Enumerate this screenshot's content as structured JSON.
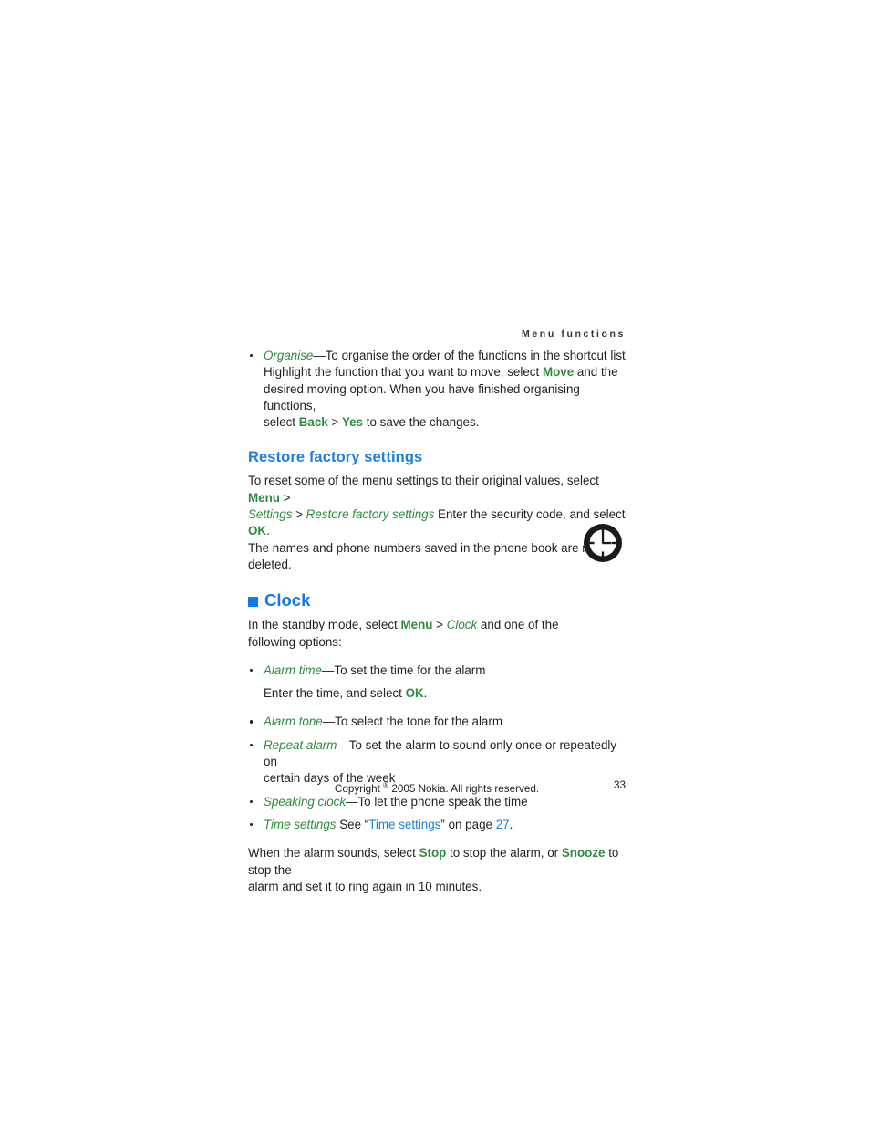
{
  "header": {
    "running_head": "Menu functions"
  },
  "organise_bullet": {
    "term": "Organise",
    "dash_desc": "—To organise the order of the functions in the shortcut list",
    "line2_a": "Highlight the function that you want to move, select ",
    "line2_bold": "Move",
    "line2_b": " and the",
    "line3": "desired moving option. When you have finished organising functions,",
    "line4_a": "select ",
    "line4_bold1": "Back",
    "line4_gt": " > ",
    "line4_bold2": "Yes",
    "line4_b": " to save the changes."
  },
  "restore_section": {
    "heading": "Restore factory settings",
    "p1_a": "To reset some of the menu settings to their original values, select ",
    "p1_menu": "Menu",
    "p1_gt": " >",
    "p2_settings": "Settings",
    "p2_gt": " > ",
    "p2_path": "Restore factory settings",
    "p2_b": " Enter the security code, and select ",
    "p2_ok": "OK",
    "p2_end": ".",
    "p3": "The names and phone numbers saved in the phone book are not deleted."
  },
  "clock_section": {
    "heading": "Clock",
    "icon": "clock-icon",
    "intro_a": "In the standby mode, select ",
    "intro_menu": "Menu",
    "intro_gt": " > ",
    "intro_clock": "Clock",
    "intro_b": " and one of the",
    "intro_line2": "following options:",
    "bullets": [
      {
        "term": "Alarm time",
        "desc": "—To set the time for the alarm",
        "sub_a": "Enter the time, and select ",
        "sub_bold": "OK",
        "sub_b": "."
      },
      {
        "term": "Alarm tone",
        "desc": "—To select the tone for the alarm"
      },
      {
        "term": "Repeat alarm",
        "desc": "—To set the alarm to sound only once or repeatedly on",
        "line2": "certain days of the week"
      },
      {
        "term": "Speaking clock",
        "desc": "—To let the phone speak the time"
      },
      {
        "term": "Time settings",
        "desc_a": " See “",
        "link": "Time settings",
        "desc_b": "” on page ",
        "page_link": "27",
        "desc_c": "."
      }
    ],
    "closing_a": "When the alarm sounds, select ",
    "closing_stop": "Stop",
    "closing_b": " to stop the alarm, or ",
    "closing_snooze": "Snooze",
    "closing_c": " to stop the",
    "closing_line2": "alarm and set it to ring again in 10 minutes."
  },
  "footer": {
    "copyright_pre": "Copyright ",
    "copyright_mark": "®",
    "copyright_post": " 2005 Nokia. All rights reserved.",
    "page_number": "33"
  },
  "colors": {
    "green": "#2c8c3c",
    "blue_heading": "#1a7fe0",
    "blue_chapter": "#1479e8",
    "body": "#231f20"
  }
}
